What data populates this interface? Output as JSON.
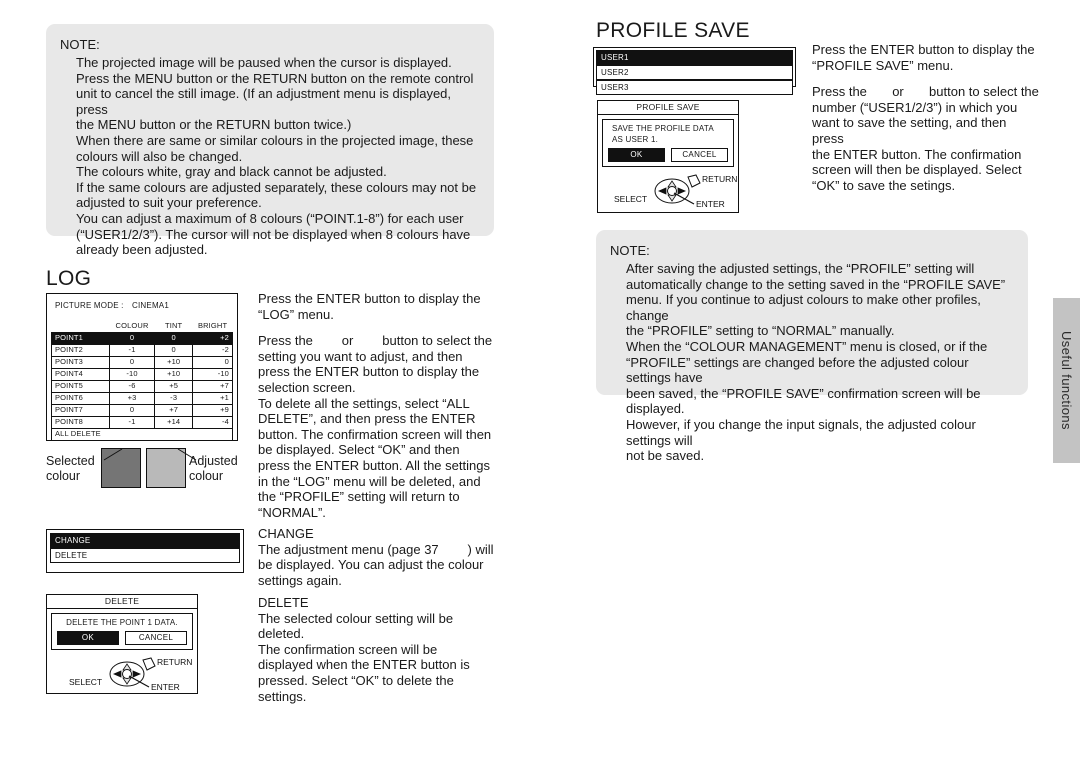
{
  "note_top": {
    "title": "NOTE:",
    "lines": [
      "The projected image will be paused when the cursor is displayed.",
      "Press the MENU button or the RETURN button on the remote control\nunit to cancel the still image. (If an adjustment menu is displayed, press\nthe MENU button or the RETURN button twice.)",
      "When there are same or similar colours in the projected image, these\ncolours will also be changed.",
      "The colours white, gray and black cannot be adjusted.",
      "If the same colours are adjusted separately, these colours may not be\nadjusted to suit your preference.",
      "You can adjust a maximum of 8 colours (“POINT.1-8”) for each user\n(“USER1/2/3”). The cursor will not be displayed when 8 colours have\nalready been adjusted."
    ]
  },
  "log": {
    "heading": "LOG",
    "screen": {
      "picture_mode_label": "PICTURE MODE  :",
      "picture_mode_value": "CINEMA1",
      "columns": [
        "",
        "COLOUR",
        "TINT",
        "BRIGHT"
      ],
      "rows": [
        {
          "label": "POINT1",
          "colour": "0",
          "tint": "0",
          "bright": "+2",
          "selected": true
        },
        {
          "label": "POINT2",
          "colour": "-1",
          "tint": "0",
          "bright": "-2",
          "selected": false
        },
        {
          "label": "POINT3",
          "colour": "0",
          "tint": "+10",
          "bright": "0",
          "selected": false
        },
        {
          "label": "POINT4",
          "colour": "-10",
          "tint": "+10",
          "bright": "-10",
          "selected": false
        },
        {
          "label": "POINT5",
          "colour": "-6",
          "tint": "+5",
          "bright": "+7",
          "selected": false
        },
        {
          "label": "POINT6",
          "colour": "+3",
          "tint": "-3",
          "bright": "+1",
          "selected": false
        },
        {
          "label": "POINT7",
          "colour": "0",
          "tint": "+7",
          "bright": "+9",
          "selected": false
        },
        {
          "label": "POINT8",
          "colour": "-1",
          "tint": "+14",
          "bright": "-4",
          "selected": false
        }
      ],
      "all_delete": "ALL DELETE"
    },
    "swatches": {
      "selected_label": "Selected\ncolour",
      "adjusted_label": "Adjusted\ncolour",
      "selected_color": "#757575",
      "adjusted_color": "#b9b9b9"
    },
    "change_menu": {
      "items": [
        {
          "label": "CHANGE",
          "selected": true
        },
        {
          "label": "DELETE",
          "selected": false
        }
      ]
    },
    "delete_dialog": {
      "title": "DELETE",
      "message": "DELETE THE POINT 1 DATA.",
      "ok": "OK",
      "cancel": "CANCEL",
      "select": "SELECT",
      "return": "RETURN",
      "enter": "ENTER"
    },
    "text": {
      "p1": "Press the ENTER button to display the\n“LOG” menu.",
      "p2": "Press the        or        button to select the\nsetting you want to adjust, and then\npress the ENTER button to display the\nselection screen.",
      "p3": "To delete all the settings, select “ALL\nDELETE”, and then press the ENTER\nbutton. The confirmation screen will then\nbe displayed. Select “OK” and then\npress the ENTER button. All the settings\nin the “LOG” menu will be deleted, and\nthe “PROFILE” setting will return to\n“NORMAL”.",
      "change_head": "CHANGE",
      "change_body": "The adjustment menu (page 37        ) will\nbe displayed. You can adjust the colour\nsettings again.",
      "delete_head": "DELETE",
      "delete_body": "The selected colour setting will be deleted.\nThe confirmation screen will be\ndisplayed when the ENTER button is\npressed. Select “OK” to delete the\nsettings."
    }
  },
  "profile_save": {
    "heading": "PROFILE SAVE",
    "user_list": [
      {
        "label": "USER1",
        "selected": true
      },
      {
        "label": "USER2",
        "selected": false
      },
      {
        "label": "USER3",
        "selected": false
      }
    ],
    "dialog": {
      "title": "PROFILE SAVE",
      "message": "SAVE THE PROFILE DATA\nAS USER 1.",
      "ok": "OK",
      "cancel": "CANCEL",
      "select": "SELECT",
      "return": "RETURN",
      "enter": "ENTER"
    },
    "text": {
      "p1": "Press the ENTER button to display the\n“PROFILE SAVE” menu.",
      "p2": "Press the       or       button to select the\nnumber (“USER1/2/3”) in which you\nwant to save the setting, and then press\nthe ENTER button. The confirmation\nscreen will then be displayed. Select\n“OK” to save the setings."
    }
  },
  "note_bottom": {
    "title": "NOTE:",
    "lines": [
      "After saving the adjusted settings, the “PROFILE” setting will\nautomatically change to the setting saved in the “PROFILE SAVE”\nmenu. If you continue to adjust colours to make other profiles, change\nthe “PROFILE” setting to “NORMAL” manually.",
      "When the “COLOUR MANAGEMENT” menu is closed, or if the\n“PROFILE” settings are changed before the adjusted colour settings have\nbeen saved, the “PROFILE SAVE” confirmation screen will be displayed.\nHowever, if you change the input signals, the adjusted colour settings will\nnot be saved."
    ]
  },
  "side_tab": {
    "label": "Useful functions"
  }
}
